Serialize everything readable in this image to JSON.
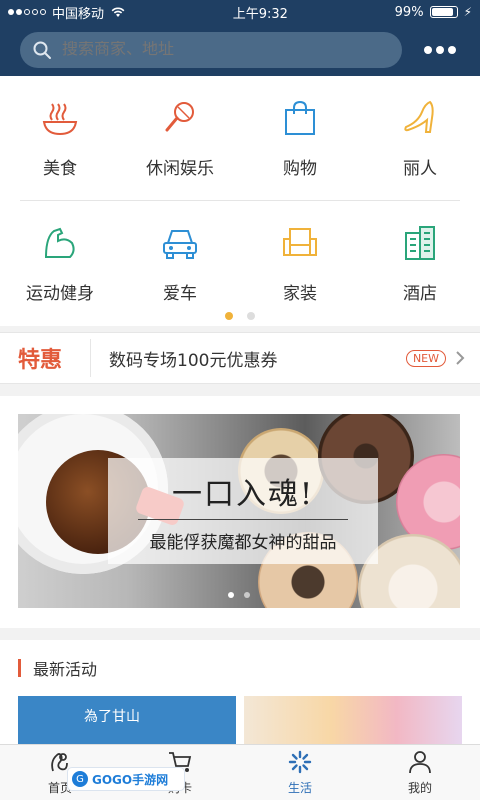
{
  "status": {
    "carrier": "中国移动",
    "time": "上午9:32",
    "battery_pct": "99%"
  },
  "header": {
    "search_placeholder": "搜索商家、地址"
  },
  "categories": [
    {
      "label": "美食",
      "icon": "noodle-bowl-icon",
      "color": "#e25b3b"
    },
    {
      "label": "休闲娱乐",
      "icon": "microphone-icon",
      "color": "#e25b3b"
    },
    {
      "label": "购物",
      "icon": "shopping-bag-icon",
      "color": "#2d8fd5"
    },
    {
      "label": "丽人",
      "icon": "high-heel-icon",
      "color": "#f0b23a"
    },
    {
      "label": "运动健身",
      "icon": "muscle-arm-icon",
      "color": "#2aa57a"
    },
    {
      "label": "爱车",
      "icon": "car-icon",
      "color": "#2d8fd5"
    },
    {
      "label": "家装",
      "icon": "armchair-icon",
      "color": "#f0b23a"
    },
    {
      "label": "酒店",
      "icon": "building-icon",
      "color": "#2aa57a"
    }
  ],
  "promo": {
    "badge": "特惠",
    "text": "数码专场100元优惠券",
    "new_label": "NEW"
  },
  "banner": {
    "title": "一口入魂!",
    "subtitle": "最能俘获魔都女神的甜品"
  },
  "activities": {
    "title": "最新活动",
    "tile1_text": "為了甘山"
  },
  "tabs": [
    {
      "label": "首页",
      "icon": "home-icon"
    },
    {
      "label": "购卡",
      "icon": "cart-icon"
    },
    {
      "label": "生活",
      "icon": "life-icon"
    },
    {
      "label": "我的",
      "icon": "user-icon"
    }
  ],
  "watermark": {
    "text": "GOGO手游网"
  },
  "colors": {
    "header_bg": "#1f3f63",
    "accent_red": "#e25b3b",
    "tab_active": "#2e6fb6"
  }
}
